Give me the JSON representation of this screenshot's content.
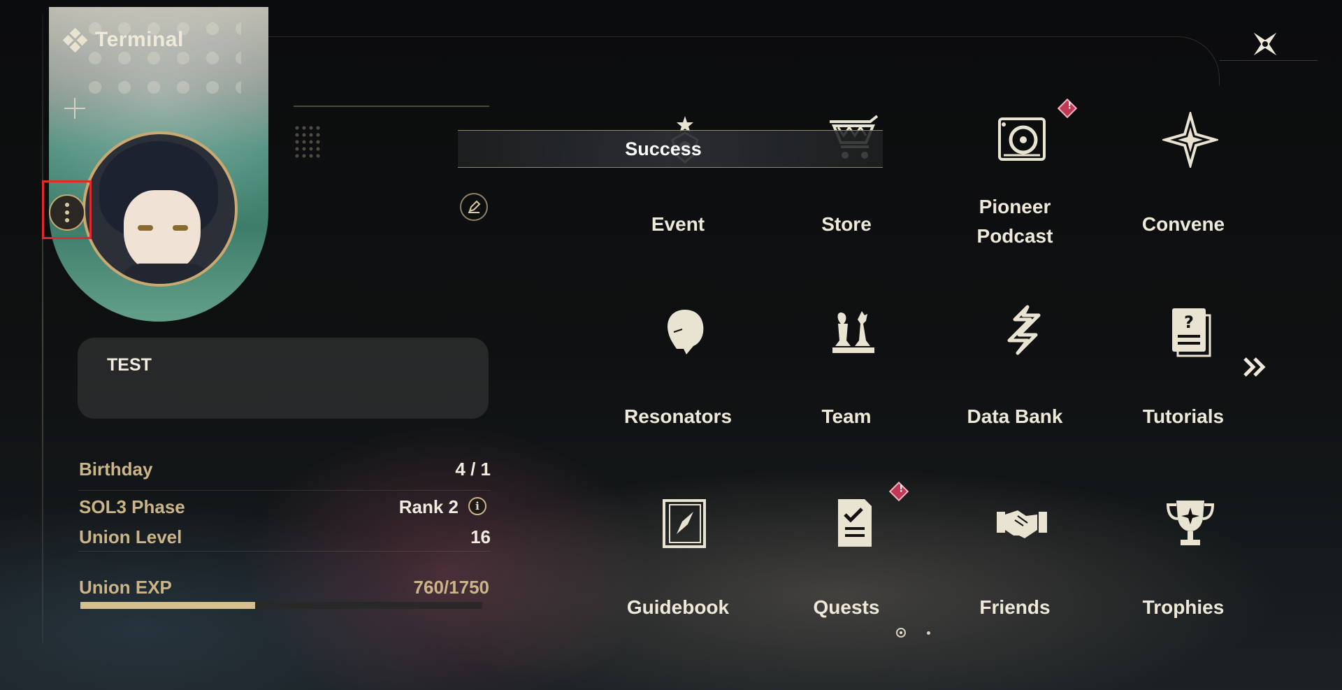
{
  "header": {
    "title": "Terminal",
    "title_icon": "terminal-diamonds-icon",
    "close_icon": "close-star-icon"
  },
  "profile": {
    "more_icon": "vertical-ellipsis-icon",
    "edit_icon": "pencil-icon",
    "signature": "TEST",
    "stats": {
      "birthday_label": "Birthday",
      "birthday_value": "4 / 1",
      "sol3_label": "SOL3 Phase",
      "sol3_value": "Rank 2",
      "sol3_info_icon": "info-icon",
      "union_level_label": "Union Level",
      "union_level_value": "16",
      "union_exp_label": "Union EXP",
      "union_exp_value": "760/1750",
      "union_exp_progress": 0.434
    }
  },
  "toast": {
    "text": "Success"
  },
  "menu": {
    "items": [
      {
        "label": "Event",
        "icon": "event-star-icon"
      },
      {
        "label": "Store",
        "icon": "shopping-cart-icon"
      },
      {
        "label": "Pioneer Podcast",
        "icon": "podcast-turntable-icon",
        "badge": true
      },
      {
        "label": "Convene",
        "icon": "compass-star-icon"
      },
      {
        "label": "Resonators",
        "icon": "character-head-icon"
      },
      {
        "label": "Team",
        "icon": "chess-pieces-icon"
      },
      {
        "label": "Data Bank",
        "icon": "data-bank-icon"
      },
      {
        "label": "Tutorials",
        "icon": "tutorial-card-icon"
      },
      {
        "label": "Guidebook",
        "icon": "guidebook-compass-icon"
      },
      {
        "label": "Quests",
        "icon": "quest-clipboard-icon",
        "badge": true
      },
      {
        "label": "Friends",
        "icon": "handshake-icon"
      },
      {
        "label": "Trophies",
        "icon": "trophy-icon"
      }
    ],
    "next_icon": "double-chevron-right-icon",
    "pages": 2,
    "current_page": 1
  },
  "colors": {
    "accent_gold": "#caa970",
    "badge_red": "#c23854",
    "text_light": "#efe9da",
    "label_gold": "#cbb488"
  }
}
